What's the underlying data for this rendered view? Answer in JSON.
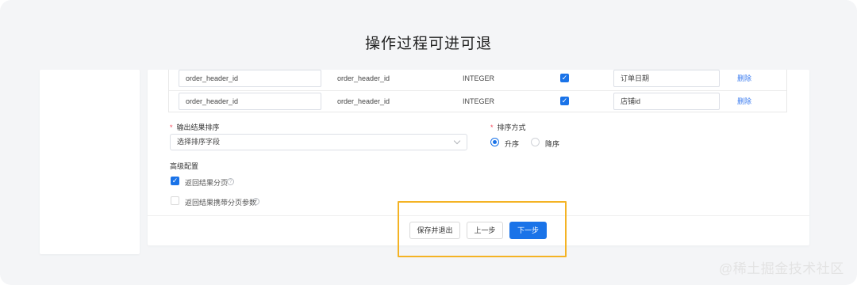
{
  "heading": "操作过程可进可退",
  "table": {
    "rows": [
      {
        "source_field": "order_header_id",
        "target_field": "order_header_id",
        "type": "INTEGER",
        "checked": true,
        "alias": "订单日期",
        "action": "删除"
      },
      {
        "source_field": "order_header_id",
        "target_field": "order_header_id",
        "type": "INTEGER",
        "checked": true,
        "alias": "店铺id",
        "action": "删除"
      }
    ]
  },
  "sort": {
    "required_mark": "*",
    "field_label": "输出结果排序",
    "field_placeholder": "选择排序字段",
    "method_label": "排序方式",
    "options": [
      "升序",
      "降序"
    ],
    "selected": "升序"
  },
  "advanced": {
    "title": "高级配置",
    "options": [
      {
        "label": "返回结果分页",
        "checked": true
      },
      {
        "label": "返回结果携带分页参数",
        "checked": false
      }
    ],
    "help_icon": "question-circle-icon"
  },
  "actions": {
    "save_exit": "保存并退出",
    "prev": "上一步",
    "next": "下一步"
  },
  "colors": {
    "primary": "#1a73e8",
    "highlight": "#f4b324",
    "required": "#f5475b",
    "link": "#3b7cf0"
  },
  "watermark": "@稀土掘金技术社区"
}
